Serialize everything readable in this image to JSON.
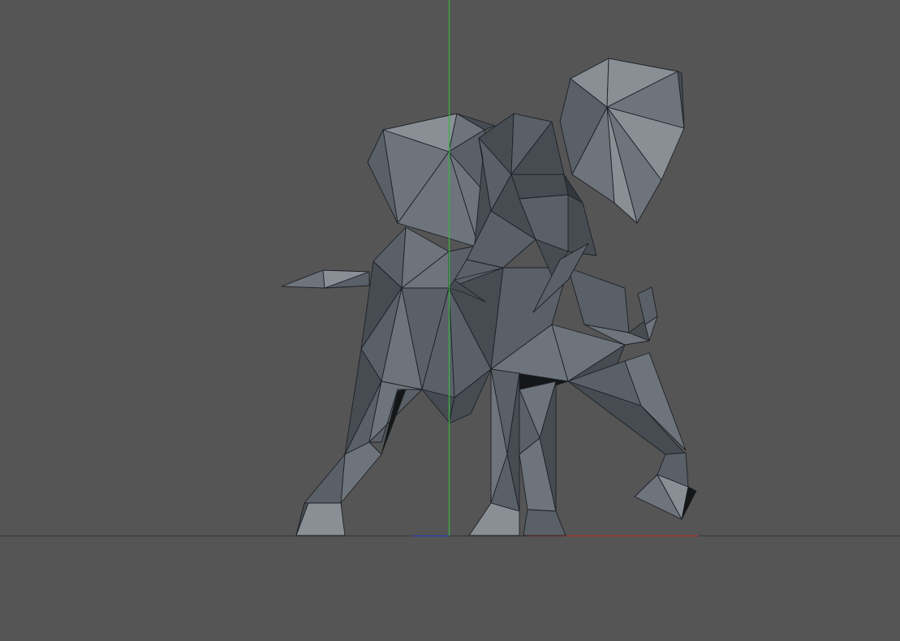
{
  "viewport": {
    "background_color": "#555555",
    "grid_line_color": "#3f3f3f",
    "y_axis_color": "#3cb043",
    "x_axis_color": "#c0392b",
    "z_axis_color": "#2a3fd0",
    "model": "low-poly-elephant",
    "mesh_colors": [
      "#8a8f96",
      "#6e747b",
      "#5a6068",
      "#474c53",
      "#33383e",
      "#141617"
    ]
  }
}
